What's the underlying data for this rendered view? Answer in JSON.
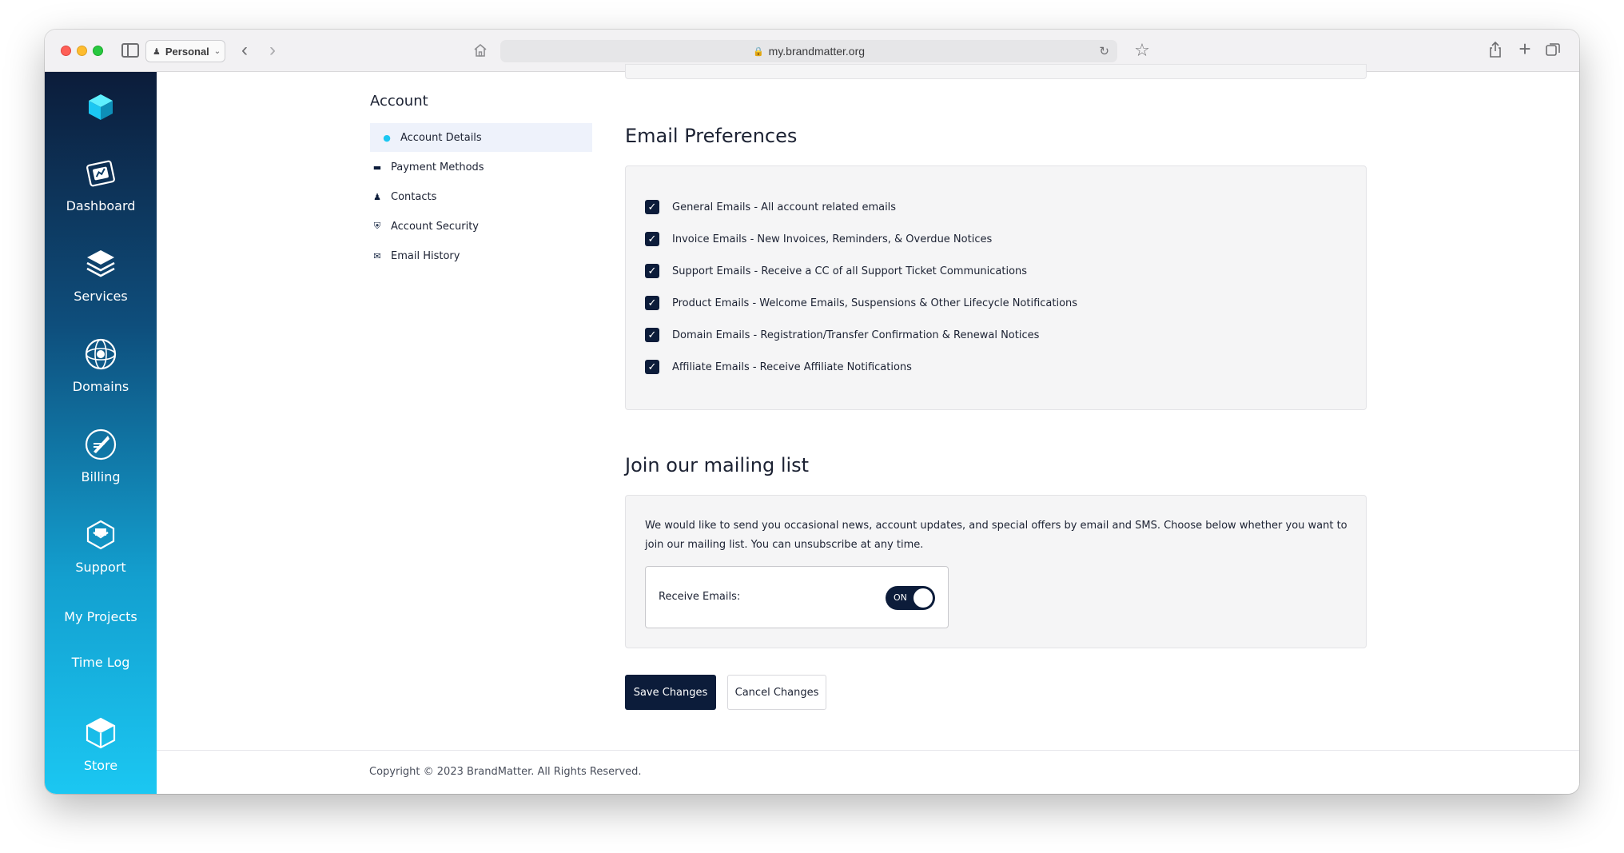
{
  "browser": {
    "profile": "Personal",
    "url": "my.brandmatter.org"
  },
  "sidebar": {
    "items": [
      {
        "label": "Dashboard",
        "icon": "dashboard-icon"
      },
      {
        "label": "Services",
        "icon": "services-icon"
      },
      {
        "label": "Domains",
        "icon": "domains-icon"
      },
      {
        "label": "Billing",
        "icon": "billing-icon"
      },
      {
        "label": "Support",
        "icon": "support-icon"
      },
      {
        "label": "My Projects"
      },
      {
        "label": "Time Log"
      },
      {
        "label": "Store",
        "icon": "store-icon"
      }
    ]
  },
  "account_nav": {
    "title": "Account",
    "items": [
      {
        "label": "Account Details",
        "icon": "user-icon",
        "active": true
      },
      {
        "label": "Payment Methods",
        "icon": "credit-card-icon"
      },
      {
        "label": "Contacts",
        "icon": "contact-icon"
      },
      {
        "label": "Account Security",
        "icon": "shield-icon"
      },
      {
        "label": "Email History",
        "icon": "envelope-icon"
      }
    ]
  },
  "email_preferences": {
    "title": "Email Preferences",
    "options": [
      {
        "label": "General Emails - All account related emails",
        "checked": true
      },
      {
        "label": "Invoice Emails - New Invoices, Reminders, & Overdue Notices",
        "checked": true
      },
      {
        "label": "Support Emails - Receive a CC of all Support Ticket Communications",
        "checked": true
      },
      {
        "label": "Product Emails - Welcome Emails, Suspensions & Other Lifecycle Notifications",
        "checked": true
      },
      {
        "label": "Domain Emails - Registration/Transfer Confirmation & Renewal Notices",
        "checked": true
      },
      {
        "label": "Affiliate Emails - Receive Affiliate Notifications",
        "checked": true
      }
    ]
  },
  "mailing_list": {
    "title": "Join our mailing list",
    "description": "We would like to send you occasional news, account updates, and special offers by email and SMS. Choose below whether you want to join our mailing list. You can unsubscribe at any time.",
    "receive_label": "Receive Emails:",
    "toggle_text": "ON"
  },
  "actions": {
    "save": "Save Changes",
    "cancel": "Cancel Changes"
  },
  "footer": {
    "copyright": "Copyright © 2023 BrandMatter. All Rights Reserved."
  },
  "colors": {
    "navy": "#0c1c3a",
    "accent": "#1bc7f2",
    "card": "#f5f5f6"
  }
}
